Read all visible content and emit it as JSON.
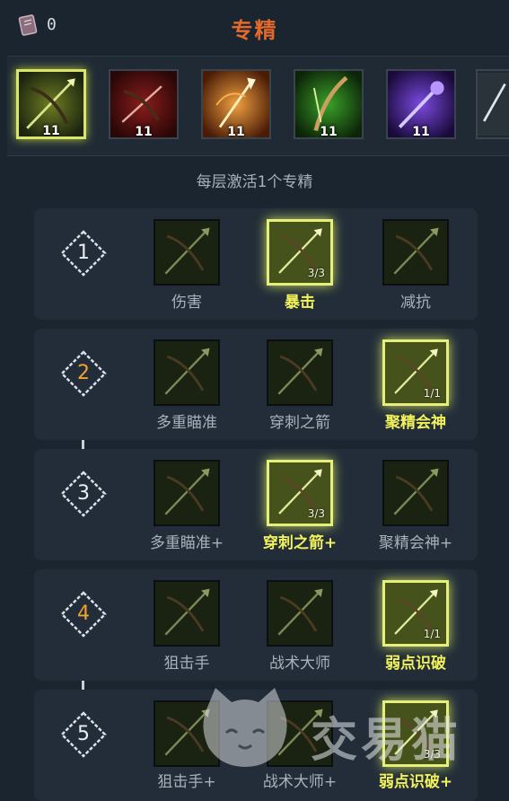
{
  "header": {
    "points": "0",
    "title": "专精",
    "book_icon": "skill-book-icon"
  },
  "weapons": [
    {
      "name": "bow-spear-weapon",
      "level": "11",
      "selected": true,
      "color": "#8a9a2a"
    },
    {
      "name": "crossbow-weapon",
      "level": "11",
      "selected": false,
      "color": "#8a1c1c"
    },
    {
      "name": "flame-spear-weapon",
      "level": "11",
      "selected": false,
      "color": "#d46a1a"
    },
    {
      "name": "green-bow-weapon",
      "level": "11",
      "selected": false,
      "color": "#2f8a24"
    },
    {
      "name": "purple-staff-weapon",
      "level": "11",
      "selected": false,
      "color": "#5a2ab0"
    },
    {
      "name": "blade-weapon",
      "level": "",
      "selected": false,
      "color": "#4a5560"
    }
  ],
  "hint": "每层激活1个专精",
  "tiers": [
    {
      "node": "1",
      "active": false,
      "skills": [
        {
          "label": "伤害",
          "rank": "",
          "selected": false
        },
        {
          "label": "暴击",
          "rank": "3/3",
          "selected": true
        },
        {
          "label": "减抗",
          "rank": "",
          "selected": false
        }
      ]
    },
    {
      "node": "2",
      "active": true,
      "skills": [
        {
          "label": "多重瞄准",
          "rank": "",
          "selected": false
        },
        {
          "label": "穿刺之箭",
          "rank": "",
          "selected": false
        },
        {
          "label": "聚精会神",
          "rank": "1/1",
          "selected": true
        }
      ]
    },
    {
      "node": "3",
      "active": false,
      "skills": [
        {
          "label": "多重瞄准+",
          "rank": "",
          "selected": false
        },
        {
          "label": "穿刺之箭+",
          "rank": "3/3",
          "selected": true
        },
        {
          "label": "聚精会神+",
          "rank": "",
          "selected": false
        }
      ]
    },
    {
      "node": "4",
      "active": true,
      "skills": [
        {
          "label": "狙击手",
          "rank": "",
          "selected": false
        },
        {
          "label": "战术大师",
          "rank": "",
          "selected": false
        },
        {
          "label": "弱点识破",
          "rank": "1/1",
          "selected": true
        }
      ]
    },
    {
      "node": "5",
      "active": false,
      "skills": [
        {
          "label": "狙击手+",
          "rank": "",
          "selected": false
        },
        {
          "label": "战术大师+",
          "rank": "",
          "selected": false
        },
        {
          "label": "弱点识破+",
          "rank": "3/3",
          "selected": true
        }
      ]
    }
  ],
  "watermark": {
    "text": "交易猫",
    "icon": "cat-logo-icon"
  },
  "colors": {
    "accent": "#e46a2c",
    "selected_border": "#e4f07a",
    "selected_label": "#f2f25a",
    "active_node": "#f1a32c"
  }
}
